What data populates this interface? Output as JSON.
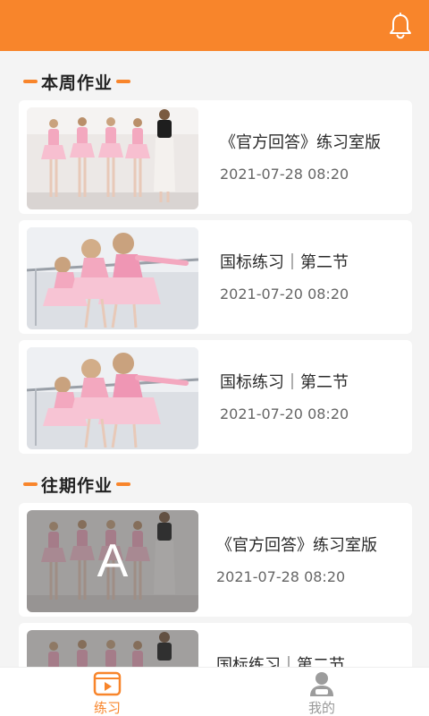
{
  "header": {
    "bell_icon": "bell-icon",
    "accent": "#f8852b"
  },
  "sections": [
    {
      "title": "本周作业"
    },
    {
      "title": "往期作业"
    }
  ],
  "this_week": [
    {
      "title": "《官方回答》练习室版",
      "date": "2021-07-28 08:20",
      "thumb": "dancers-standing"
    },
    {
      "title": "国标练习｜第二节",
      "date": "2021-07-20 08:20",
      "thumb": "dancers-barre"
    },
    {
      "title": "国标练习｜第二节",
      "date": "2021-07-20 08:20",
      "thumb": "dancers-barre"
    }
  ],
  "past": [
    {
      "title": "《官方回答》练习室版",
      "date": "2021-07-28 08:20",
      "thumb": "dancers-standing",
      "overlay_letter": "A"
    },
    {
      "title": "国标练习｜第二节",
      "date": "",
      "thumb": "dancers-standing"
    }
  ],
  "tabs": [
    {
      "label": "练习",
      "icon": "video-play-icon",
      "active": true,
      "color": "#f8852b"
    },
    {
      "label": "我的",
      "icon": "user-icon",
      "active": false,
      "color": "#999999"
    }
  ]
}
